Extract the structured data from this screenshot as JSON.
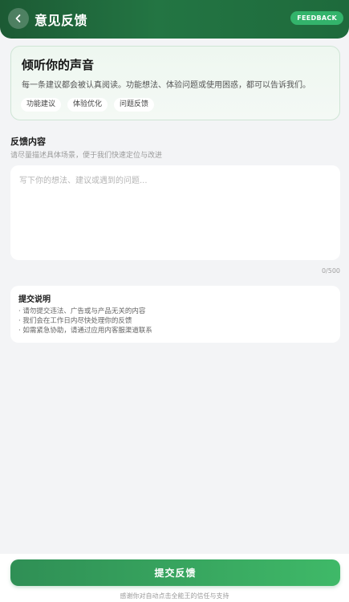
{
  "header": {
    "title": "意见反馈",
    "badge": "FEEDBACK",
    "back_icon": "chevron-left-icon"
  },
  "intro": {
    "title": "倾听你的声音",
    "description": "每一条建议都会被认真阅读。功能想法、体验问题或使用困惑，都可以告诉我们。",
    "tags": [
      "功能建议",
      "体验优化",
      "问题反馈"
    ]
  },
  "feedback": {
    "title": "反馈内容",
    "subtitle": "请尽量描述具体场景，便于我们快速定位与改进",
    "placeholder": "写下你的想法、建议或遇到的问题...",
    "value": "",
    "counter": "0/500"
  },
  "notes": {
    "title": "提交说明",
    "items": [
      "· 请勿提交违法、广告或与产品无关的内容",
      "· 我们会在工作日内尽快处理你的反馈",
      "· 如需紧急协助，请通过应用内客服渠道联系"
    ]
  },
  "footer": {
    "submit_label": "提交反馈",
    "thanks": "感谢你对自动点击全能王的信任与支持"
  },
  "colors": {
    "header": "#237543",
    "accent": "#3fb968",
    "badge": "#33b36b"
  }
}
